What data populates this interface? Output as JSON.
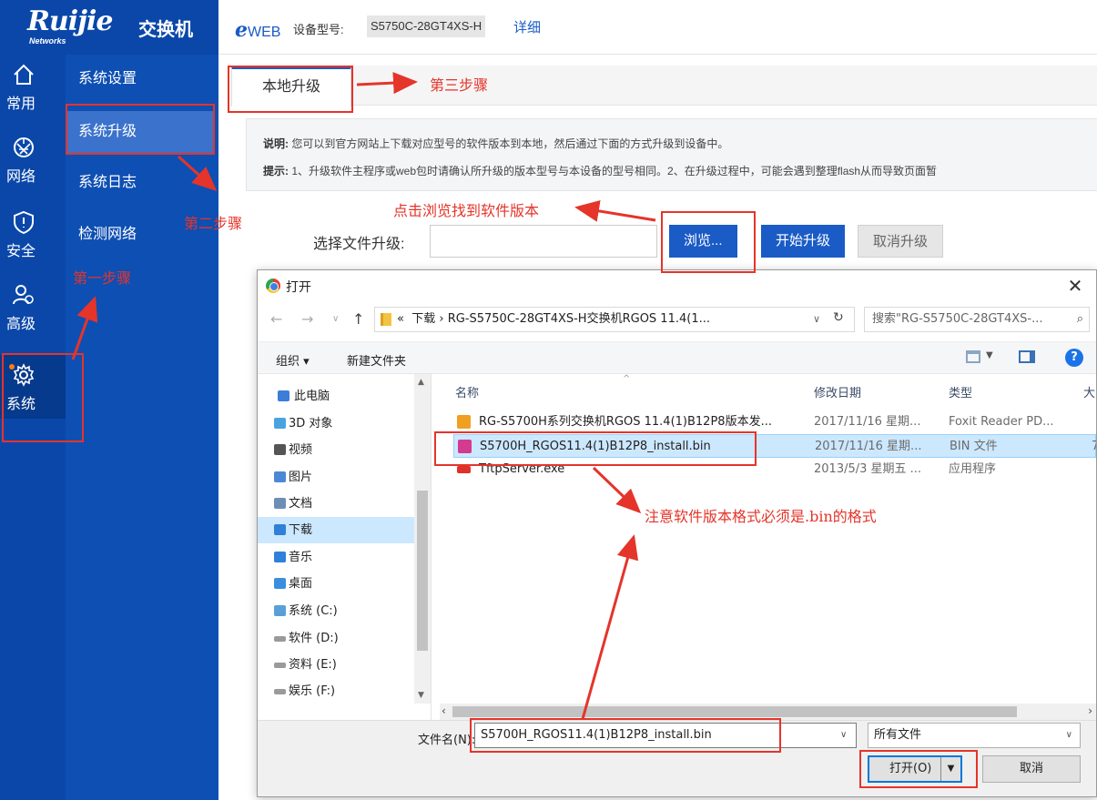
{
  "header": {
    "brand": "Ruijie",
    "brand_sub": "Networks",
    "product": "交换机",
    "eweb_e": "e",
    "eweb_rest": "WEB",
    "model_label": "设备型号:",
    "model_value": "S5750C-28GT4XS-H",
    "detail_link": "详细"
  },
  "rail": {
    "items": [
      {
        "label": "常用",
        "icon": "home-icon"
      },
      {
        "label": "网络",
        "icon": "network-icon"
      },
      {
        "label": "安全",
        "icon": "shield-icon"
      },
      {
        "label": "高级",
        "icon": "users-icon"
      },
      {
        "label": "系统",
        "icon": "gear-icon"
      }
    ]
  },
  "subnav": {
    "items": [
      {
        "label": "系统设置"
      },
      {
        "label": "系统升级"
      },
      {
        "label": "系统日志"
      },
      {
        "label": "检测网络"
      }
    ]
  },
  "content": {
    "tab_label": "本地升级",
    "note_label": "说明:",
    "note_text": "您可以到官方网站上下载对应型号的软件版本到本地，然后通过下面的方式升级到设备中。",
    "tip_label": "提示:",
    "tip_text": "1、升级软件主程序或web包时请确认所升级的版本型号与本设备的型号相同。2、在升级过程中，可能会遇到整理flash从而导致页面暂",
    "upload_label": "选择文件升级:",
    "browse_button": "浏览...",
    "start_button": "开始升级",
    "cancel_button": "取消升级"
  },
  "dialog": {
    "title": "打开",
    "close_glyph": "✕",
    "address_sep": "«",
    "address_path": "下载 › RG-S5750C-28GT4XS-H交换机RGOS 11.4(1...",
    "search_placeholder": "搜索\"RG-S5750C-28GT4XS-...",
    "toolbar_organize": "组织 ▾",
    "toolbar_new_folder": "新建文件夹",
    "help_glyph": "?",
    "tree": [
      {
        "label": "此电脑",
        "icon": "computer-icon",
        "color": "#3b7dd8"
      },
      {
        "label": "3D 对象",
        "icon": "3d-objects-icon",
        "color": "#4aa3df"
      },
      {
        "label": "视频",
        "icon": "video-folder-icon",
        "color": "#555555"
      },
      {
        "label": "图片",
        "icon": "pictures-folder-icon",
        "color": "#4b88d6"
      },
      {
        "label": "文档",
        "icon": "documents-folder-icon",
        "color": "#6d8fb5"
      },
      {
        "label": "下载",
        "icon": "downloads-folder-icon",
        "color": "#2f80d8"
      },
      {
        "label": "音乐",
        "icon": "music-folder-icon",
        "color": "#2f80d8"
      },
      {
        "label": "桌面",
        "icon": "desktop-folder-icon",
        "color": "#3b8ede"
      },
      {
        "label": "系统 (C:)",
        "icon": "system-drive-icon",
        "color": "#5a9fd8"
      },
      {
        "label": "软件 (D:)",
        "icon": "drive-icon",
        "color": "#9a9a9a"
      },
      {
        "label": "资料 (E:)",
        "icon": "drive-icon",
        "color": "#9a9a9a"
      },
      {
        "label": "娱乐 (F:)",
        "icon": "drive-icon",
        "color": "#9a9a9a"
      }
    ],
    "columns": {
      "name": "名称",
      "date": "修改日期",
      "type": "类型",
      "size": "大"
    },
    "files": [
      {
        "name": "RG-S5700H系列交换机RGOS 11.4(1)B12P8版本发...",
        "date": "2017/11/16 星期...",
        "type": "Foxit Reader PD...",
        "size": "",
        "icon": "pdf-file-icon",
        "color": "#f0a020"
      },
      {
        "name": "S5700H_RGOS11.4(1)B12P8_install.bin",
        "date": "2017/11/16 星期...",
        "type": "BIN 文件",
        "size": "7",
        "icon": "bin-file-icon",
        "color": "#d23b8f"
      },
      {
        "name": "TftpServer.exe",
        "date": "2013/5/3 星期五 ...",
        "type": "应用程序",
        "size": "",
        "icon": "ruijie-app-icon",
        "color": "#e0302a"
      }
    ],
    "filename_label": "文件名(N):",
    "filename_value": "S5700H_RGOS11.4(1)B12P8_install.bin",
    "filetype_value": "所有文件",
    "open_button": "打开(O)",
    "cancel_button": "取消"
  },
  "annotations": {
    "step1": "第一步骤",
    "step2": "第二步骤",
    "step3": "第三步骤",
    "browse_hint": "点击浏览找到软件版本",
    "format_hint": "注意软件版本格式必须是.bin的格式",
    "color": "#e5342a"
  }
}
